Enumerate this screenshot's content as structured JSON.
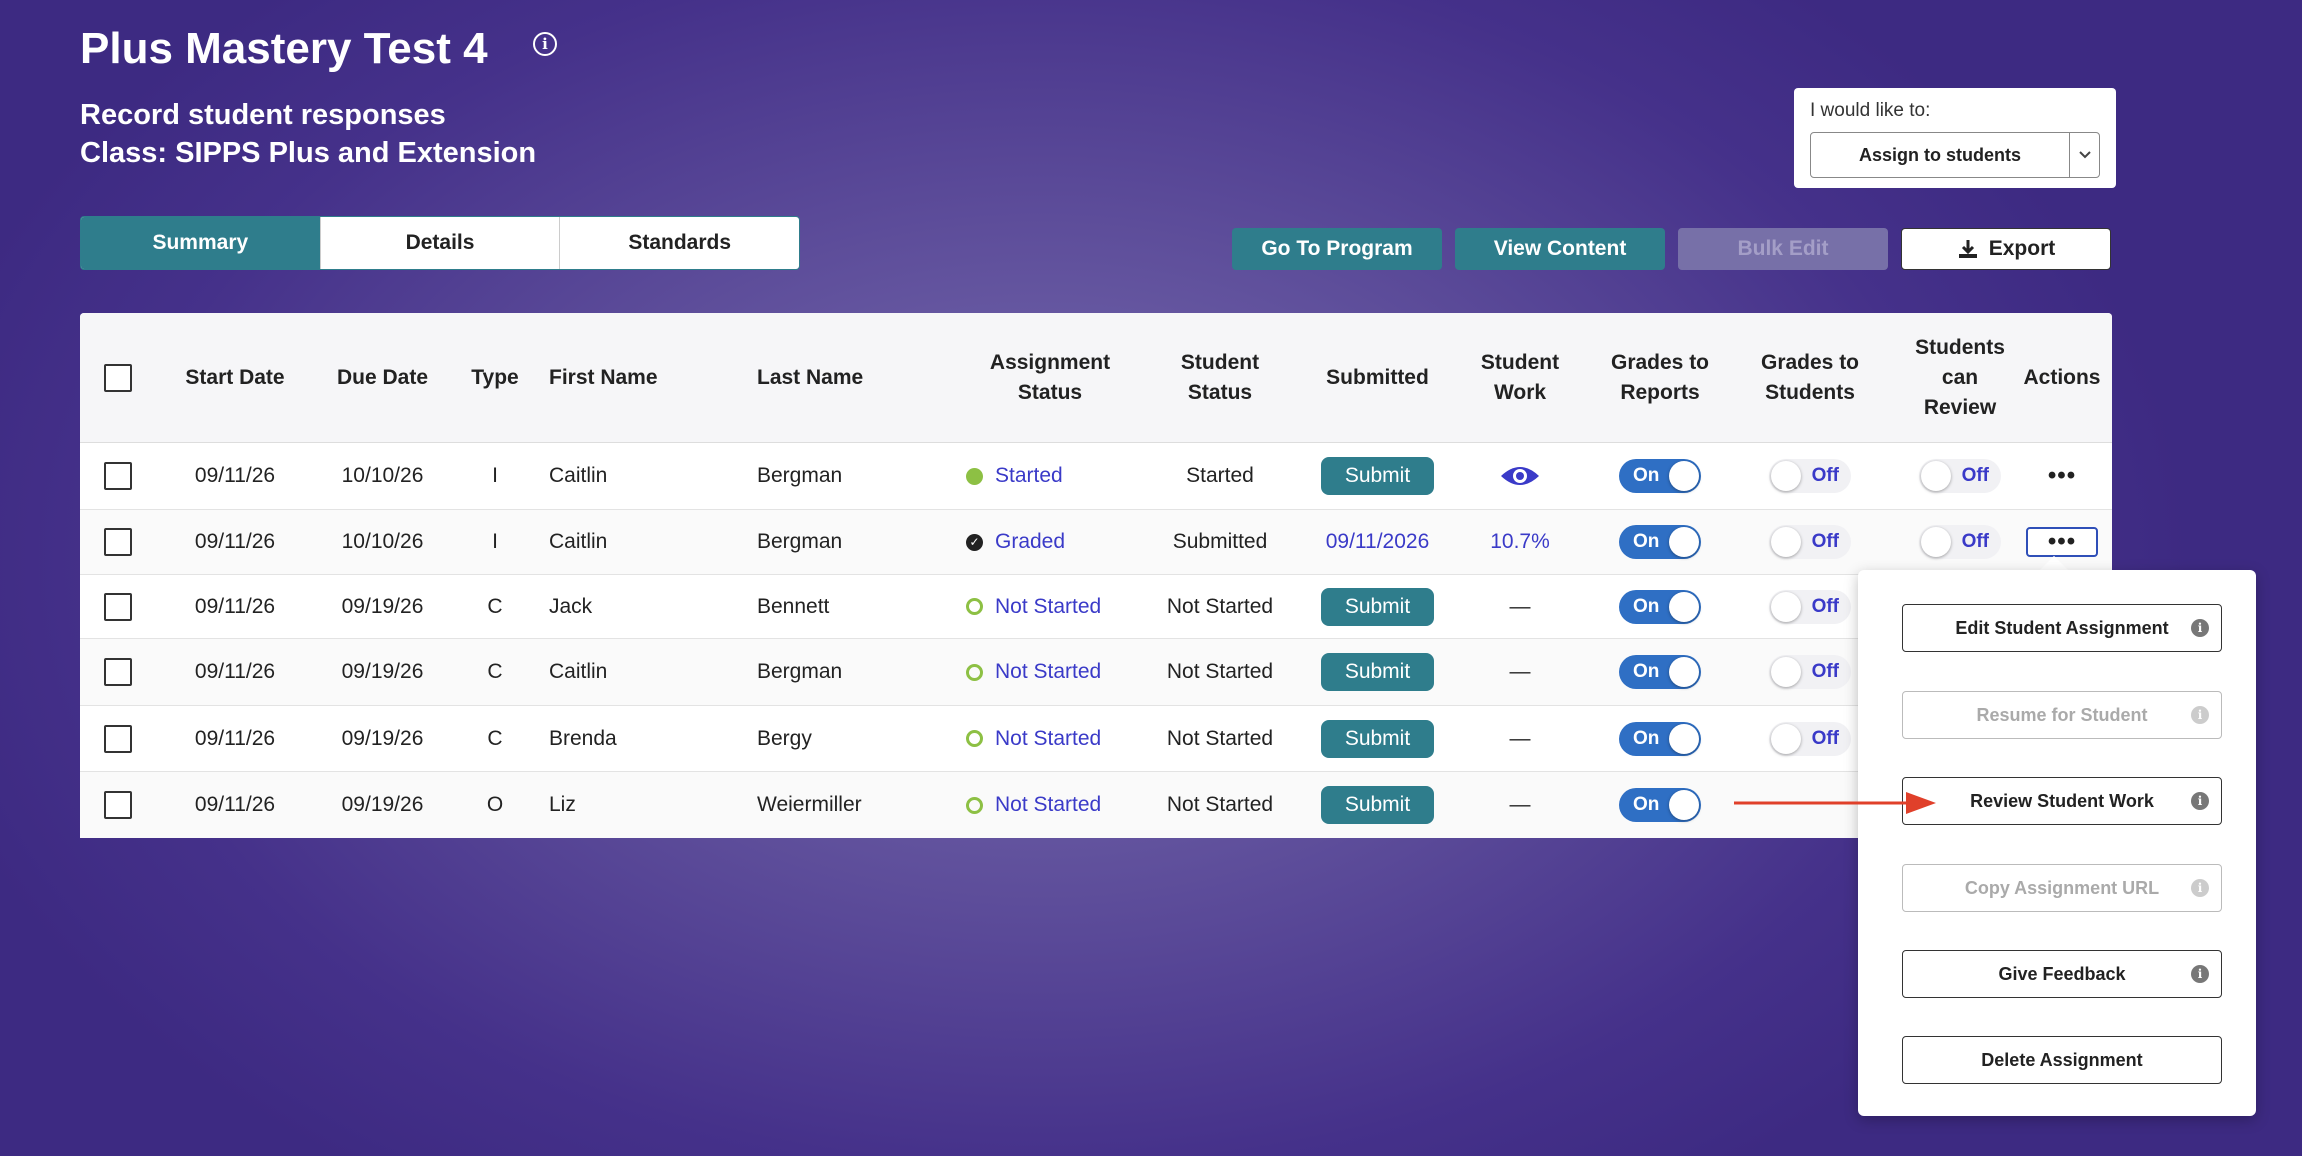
{
  "header": {
    "title": "Plus Mastery Test 4",
    "subtitle": "Record student responses",
    "class_line": "Class: SIPPS Plus and Extension",
    "info_icon": "i"
  },
  "assign_box": {
    "label": "I would like to:",
    "selected": "Assign to students"
  },
  "tabs": [
    {
      "label": "Summary",
      "active": true
    },
    {
      "label": "Details",
      "active": false
    },
    {
      "label": "Standards",
      "active": false
    }
  ],
  "toolbar": {
    "go_to_program": "Go To Program",
    "view_content": "View Content",
    "bulk_edit": "Bulk Edit",
    "export": "Export"
  },
  "table": {
    "headers": {
      "start_date": "Start Date",
      "due_date": "Due Date",
      "type": "Type",
      "first_name": "First Name",
      "last_name": "Last Name",
      "assignment_status_1": "Assignment",
      "assignment_status_2": "Status",
      "student_status_1": "Student",
      "student_status_2": "Status",
      "submitted": "Submitted",
      "student_work_1": "Student",
      "student_work_2": "Work",
      "grades_reports_1": "Grades to",
      "grades_reports_2": "Reports",
      "grades_students_1": "Grades to",
      "grades_students_2": "Students",
      "students_review_1": "Students",
      "students_review_2": "can",
      "students_review_3": "Review",
      "actions": "Actions"
    },
    "rows": [
      {
        "start": "09/11/26",
        "due": "10/10/26",
        "type": "I",
        "first": "Caitlin",
        "last": "Bergman",
        "assignment_status": "Started",
        "student_status": "Started",
        "submitted": "Submit",
        "student_work": "",
        "grades_reports": "On",
        "grades_students": "Off",
        "students_review": "Off"
      },
      {
        "start": "09/11/26",
        "due": "10/10/26",
        "type": "I",
        "first": "Caitlin",
        "last": "Bergman",
        "assignment_status": "Graded",
        "student_status": "Submitted",
        "submitted": "09/11/2026",
        "student_work": "10.7%",
        "grades_reports": "On",
        "grades_students": "Off",
        "students_review": "Off"
      },
      {
        "start": "09/11/26",
        "due": "09/19/26",
        "type": "C",
        "first": "Jack",
        "last": "Bennett",
        "assignment_status": "Not Started",
        "student_status": "Not Started",
        "submitted": "Submit",
        "student_work": "—",
        "grades_reports": "On",
        "grades_students": "Off",
        "students_review": ""
      },
      {
        "start": "09/11/26",
        "due": "09/19/26",
        "type": "C",
        "first": "Caitlin",
        "last": "Bergman",
        "assignment_status": "Not Started",
        "student_status": "Not Started",
        "submitted": "Submit",
        "student_work": "—",
        "grades_reports": "On",
        "grades_students": "Off",
        "students_review": ""
      },
      {
        "start": "09/11/26",
        "due": "09/19/26",
        "type": "C",
        "first": "Brenda",
        "last": "Bergy",
        "assignment_status": "Not Started",
        "student_status": "Not Started",
        "submitted": "Submit",
        "student_work": "—",
        "grades_reports": "On",
        "grades_students": "Off",
        "students_review": ""
      },
      {
        "start": "09/11/26",
        "due": "09/19/26",
        "type": "O",
        "first": "Liz",
        "last": "Weiermiller",
        "assignment_status": "Not Started",
        "student_status": "Not Started",
        "submitted": "Submit",
        "student_work": "—",
        "grades_reports": "On",
        "grades_students": "",
        "students_review": ""
      }
    ],
    "actions_glyph": "•••"
  },
  "actions_menu": {
    "items": [
      {
        "label": "Edit Student Assignment",
        "enabled": true
      },
      {
        "label": "Resume for Student",
        "enabled": false
      },
      {
        "label": "Review Student Work",
        "enabled": true
      },
      {
        "label": "Copy Assignment URL",
        "enabled": false
      },
      {
        "label": "Give Feedback",
        "enabled": true
      },
      {
        "label": "Delete Assignment",
        "enabled": true
      }
    ],
    "info_glyph": "i"
  },
  "colors": {
    "teal": "#2f7d8c",
    "toggle_on": "#2f6fc4",
    "link_blue": "#3a3ac8",
    "status_green": "#8dc044",
    "arrow_red": "#e0402a"
  },
  "icons": {
    "info": "info-icon",
    "chevron": "chevron-down-icon",
    "download": "download-icon",
    "eye": "eye-icon",
    "check": "check-circle-icon",
    "more": "more-dots-icon"
  }
}
